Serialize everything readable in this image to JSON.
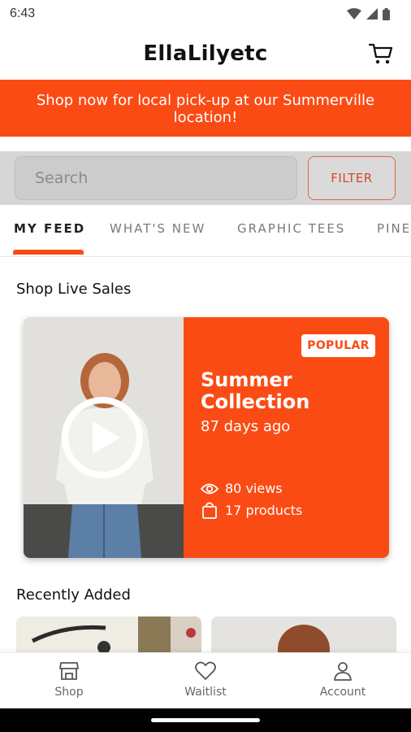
{
  "status_bar": {
    "time": "6:43"
  },
  "header": {
    "title": "EllaLilyetc"
  },
  "promo_banner": {
    "text": "Shop now for local pick-up at our Summerville location!"
  },
  "search": {
    "placeholder": "Search",
    "filter_label": "FILTER"
  },
  "tabs": [
    "MY FEED",
    "WHAT'S NEW",
    "GRAPHIC TEES",
    "PINE"
  ],
  "live_sales": {
    "section_title": "Shop Live Sales",
    "badge": "POPULAR",
    "title": "Summer Collection",
    "age": "87 days ago",
    "views": "80 views",
    "products": "17 products"
  },
  "recently_added": {
    "section_title": "Recently Added"
  },
  "bottom_nav": [
    {
      "label": "Shop",
      "icon": "store-icon"
    },
    {
      "label": "Waitlist",
      "icon": "heart-icon"
    },
    {
      "label": "Account",
      "icon": "person-icon"
    }
  ],
  "colors": {
    "accent": "#fb4b15",
    "filter_text": "#d24a25"
  }
}
